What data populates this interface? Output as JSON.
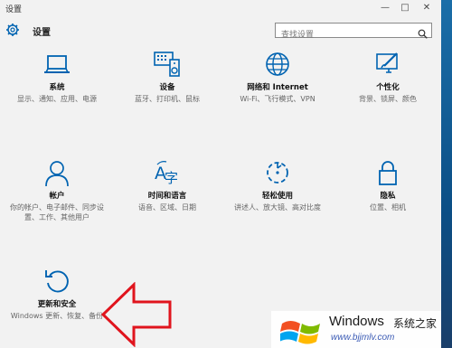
{
  "window": {
    "title": "设置",
    "controls": {
      "minimize": "—",
      "maximize": "□",
      "close": "✕"
    }
  },
  "header": {
    "title": "设置",
    "search_placeholder": "查找设置"
  },
  "tiles": [
    {
      "title": "系统",
      "desc": "显示、通知、应用、电源",
      "icon": "laptop-icon"
    },
    {
      "title": "设备",
      "desc": "蓝牙、打印机、鼠标",
      "icon": "devices-icon"
    },
    {
      "title": "网络和 Internet",
      "desc": "Wi-Fi、飞行模式、VPN",
      "icon": "globe-icon"
    },
    {
      "title": "个性化",
      "desc": "背景、锁屏、颜色",
      "icon": "personalization-icon"
    },
    {
      "title": "帐户",
      "desc": "你的帐户、电子邮件、同步设置、工作、其他用户",
      "icon": "person-icon"
    },
    {
      "title": "时间和语言",
      "desc": "语音、区域、日期",
      "icon": "time-language-icon"
    },
    {
      "title": "轻松使用",
      "desc": "讲述人、放大镜、高对比度",
      "icon": "ease-of-access-icon"
    },
    {
      "title": "隐私",
      "desc": "位置、相机",
      "icon": "lock-icon"
    },
    {
      "title": "更新和安全",
      "desc": "Windows 更新、恢复、备份",
      "icon": "update-icon"
    }
  ],
  "watermark": {
    "brand": "Windows",
    "cn": "系统之家",
    "url": "www.bjjmlv.com"
  },
  "colors": {
    "accent": "#0063b1",
    "arrow": "#e0141d",
    "background": "#f2f2f2"
  }
}
